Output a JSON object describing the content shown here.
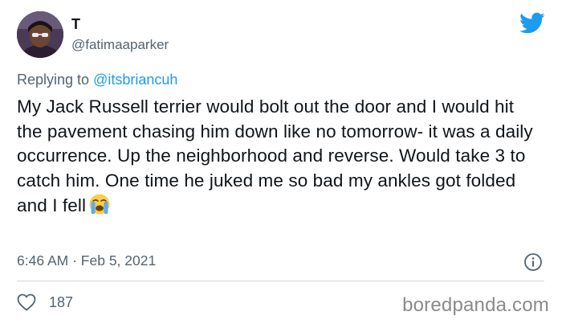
{
  "author": {
    "display_name": "T",
    "handle": "@fatimaaparker"
  },
  "reply": {
    "prefix": "Replying to",
    "mention": "@itsbriancuh"
  },
  "tweet": {
    "text": "My Jack Russell terrier would bolt out the door and I would hit the pavement chasing him down like no tomorrow- it was a daily occurrence. Up the neighborhood and reverse. Would take 3 to catch him. One time he juked me so bad my ankles got folded and I fell",
    "emoji": "loudly-crying-face-icon"
  },
  "meta": {
    "time": "6:46 AM",
    "separator": "·",
    "date": "Feb 5, 2021"
  },
  "engagement": {
    "likes": "187"
  },
  "watermark": "boredpanda.com",
  "colors": {
    "twitter_blue": "#1d9bf0",
    "secondary_text": "#536471",
    "primary_text": "#0f1419",
    "divider": "#cfd9de"
  }
}
